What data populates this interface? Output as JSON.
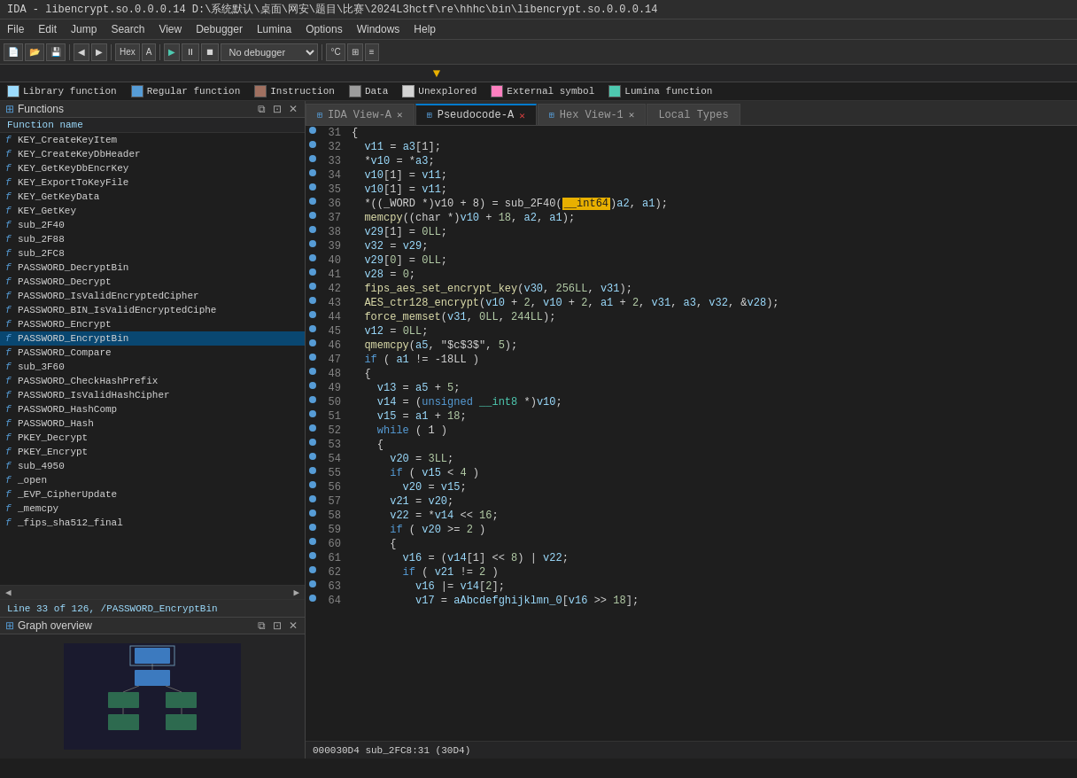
{
  "titleBar": {
    "text": "IDA - libencrypt.so.0.0.0.14 D:\\系统默认\\桌面\\网安\\题目\\比赛\\2024L3hctf\\re\\hhhc\\bin\\libencrypt.so.0.0.0.14"
  },
  "menuBar": {
    "items": [
      "File",
      "Edit",
      "Jump",
      "Search",
      "View",
      "Debugger",
      "Lumina",
      "Options",
      "Windows",
      "Help"
    ]
  },
  "toolbar": {
    "debuggerDropdown": "No debugger"
  },
  "legend": {
    "items": [
      {
        "label": "Library function",
        "color": "#9cdcfe"
      },
      {
        "label": "Regular function",
        "color": "#569cd6"
      },
      {
        "label": "Instruction",
        "color": "#a07060"
      },
      {
        "label": "Data",
        "color": "#9d9d9d"
      },
      {
        "label": "Unexplored",
        "color": "#cccccc"
      },
      {
        "label": "External symbol",
        "color": "#ff80c0"
      },
      {
        "label": "Lumina function",
        "color": "#4ec9b0"
      }
    ]
  },
  "functionsPanel": {
    "title": "Functions",
    "columnHeader": "Function name",
    "items": [
      "KEY_CreateKeyItem",
      "KEY_CreateKeyDbHeader",
      "KEY_GetKeyDbEncrKey",
      "KEY_ExportToKeyFile",
      "KEY_GetKeyData",
      "KEY_GetKey",
      "sub_2F40",
      "sub_2F88",
      "sub_2FC8",
      "PASSWORD_DecryptBin",
      "PASSWORD_Decrypt",
      "PASSWORD_IsValidEncryptedCipher",
      "PASSWORD_BIN_IsValidEncryptedCiphe",
      "PASSWORD_Encrypt",
      "PASSWORD_EncryptBin",
      "PASSWORD_Compare",
      "sub_3F60",
      "PASSWORD_CheckHashPrefix",
      "PASSWORD_IsValidHashCipher",
      "PASSWORD_HashComp",
      "PASSWORD_Hash",
      "PKEY_Decrypt",
      "PKEY_Encrypt",
      "sub_4950",
      "_open",
      "_EVP_CipherUpdate",
      "_memcpy",
      "_fips_sha512_final"
    ],
    "activeItem": "PASSWORD_EncryptBin"
  },
  "lineInfo": {
    "text": "Line 33 of 126, /PASSWORD_EncryptBin"
  },
  "graphOverview": {
    "title": "Graph overview"
  },
  "tabs": [
    {
      "id": "ida-view",
      "label": "IDA View-A",
      "active": false,
      "closeable": true
    },
    {
      "id": "pseudocode",
      "label": "Pseudocode-A",
      "active": true,
      "closeable": true
    },
    {
      "id": "hex-view",
      "label": "Hex View-1",
      "active": false,
      "closeable": true
    },
    {
      "id": "local-types",
      "label": "Local Types",
      "active": false,
      "closeable": false
    }
  ],
  "statusBar": {
    "text": "000030D4 sub_2FC8:31 (30D4)"
  },
  "codeLines": [
    {
      "num": 31,
      "dot": true,
      "content": "{"
    },
    {
      "num": 32,
      "dot": true,
      "content": "  v11 = a3[1];"
    },
    {
      "num": 33,
      "dot": true,
      "content": "  *v10 = *a3;"
    },
    {
      "num": 34,
      "dot": true,
      "content": "  v10[1] = v11;"
    },
    {
      "num": 35,
      "dot": true,
      "content": "  v10[1] = v11;"
    },
    {
      "num": 36,
      "dot": true,
      "content": "  *((_WORD *)v10 + 8) = sub_2F40((__int64)a2, a1);",
      "highlight": "__int64"
    },
    {
      "num": 37,
      "dot": true,
      "content": "  memcpy((char *)v10 + 18, a2, a1);"
    },
    {
      "num": 38,
      "dot": true,
      "content": "  v29[1] = 0LL;"
    },
    {
      "num": 39,
      "dot": true,
      "content": "  v32 = v29;"
    },
    {
      "num": 40,
      "dot": true,
      "content": "  v29[0] = 0LL;"
    },
    {
      "num": 41,
      "dot": true,
      "content": "  v28 = 0;"
    },
    {
      "num": 42,
      "dot": true,
      "content": "  fips_aes_set_encrypt_key(v30, 256LL, v31);"
    },
    {
      "num": 43,
      "dot": true,
      "content": "  AES_ctr128_encrypt(v10 + 2, v10 + 2, a1 + 2, v31, a3, v32, &v28);"
    },
    {
      "num": 44,
      "dot": true,
      "content": "  force_memset(v31, 0LL, 244LL);"
    },
    {
      "num": 45,
      "dot": true,
      "content": "  v12 = 0LL;"
    },
    {
      "num": 46,
      "dot": true,
      "content": "  qmemcpy(a5, \"$c$3$\", 5);"
    },
    {
      "num": 47,
      "dot": true,
      "content": "  if ( a1 != -18LL )"
    },
    {
      "num": 48,
      "dot": true,
      "content": "  {"
    },
    {
      "num": 49,
      "dot": true,
      "content": "    v13 = a5 + 5;"
    },
    {
      "num": 50,
      "dot": true,
      "content": "    v14 = (unsigned __int8 *)v10;"
    },
    {
      "num": 51,
      "dot": true,
      "content": "    v15 = a1 + 18;"
    },
    {
      "num": 52,
      "dot": true,
      "content": "    while ( 1 )"
    },
    {
      "num": 53,
      "dot": true,
      "content": "    {"
    },
    {
      "num": 54,
      "dot": true,
      "content": "      v20 = 3LL;"
    },
    {
      "num": 55,
      "dot": true,
      "content": "      if ( v15 < 4 )"
    },
    {
      "num": 56,
      "dot": true,
      "content": "        v20 = v15;"
    },
    {
      "num": 57,
      "dot": true,
      "content": "      v21 = v20;"
    },
    {
      "num": 58,
      "dot": true,
      "content": "      v22 = *v14 << 16;"
    },
    {
      "num": 59,
      "dot": true,
      "content": "      if ( v20 >= 2 )"
    },
    {
      "num": 60,
      "dot": true,
      "content": "      {"
    },
    {
      "num": 61,
      "dot": true,
      "content": "        v16 = (v14[1] << 8) | v22;"
    },
    {
      "num": 62,
      "dot": true,
      "content": "        if ( v21 != 2 )"
    },
    {
      "num": 63,
      "dot": true,
      "content": "          v16 |= v14[2];"
    },
    {
      "num": 64,
      "dot": true,
      "content": "          v17 = aAbcdefghijklmn_0[v16 >> 18];"
    }
  ]
}
